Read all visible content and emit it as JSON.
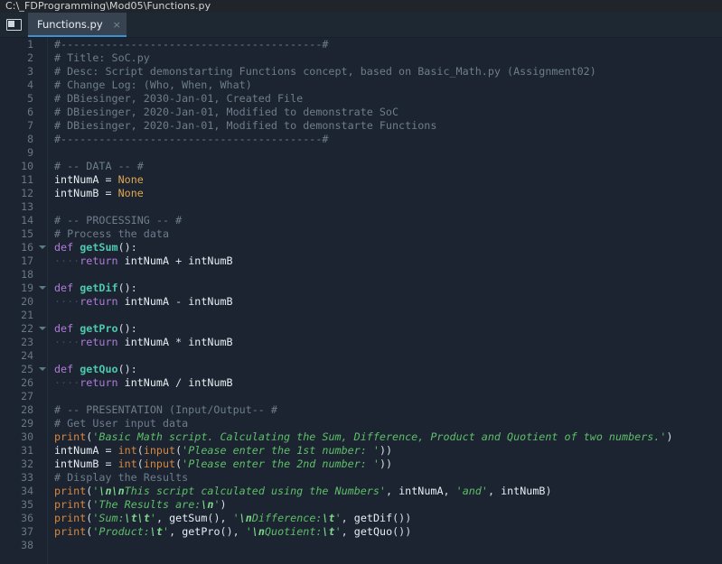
{
  "window": {
    "title": "C:\\_FDProgramming\\Mod05\\Functions.py"
  },
  "icons": {
    "panel": "panel-icon",
    "close": "×"
  },
  "tabs": [
    {
      "label": "Functions.py",
      "active": true,
      "close": "×"
    }
  ],
  "editor": {
    "first_line": 1,
    "last_line": 38,
    "fold_lines": [
      16,
      19,
      22,
      25
    ],
    "colors": {
      "background": "#1b2430",
      "gutter": "#1b2430",
      "line_number": "#697786",
      "text": "#d6dde4",
      "comment": "#6e7d8c",
      "keyword": "#b07cd8",
      "function_def": "#4ec9b0",
      "builtin": "#d8873f",
      "string": "#5fbf6a",
      "constant": "#e0a852",
      "tab_accent": "#3f90d0",
      "tab_active_bg": "#374350",
      "titlebar_bg": "#20252b"
    },
    "lines": [
      {
        "n": 1,
        "tokens": [
          {
            "c": "t-com",
            "t": "#-----------------------------------------#"
          }
        ]
      },
      {
        "n": 2,
        "tokens": [
          {
            "c": "t-com",
            "t": "# Title: SoC.py"
          }
        ]
      },
      {
        "n": 3,
        "tokens": [
          {
            "c": "t-com",
            "t": "# Desc: Script demonstarting Functions concept, based on Basic_Math.py (Assignment02)"
          }
        ]
      },
      {
        "n": 4,
        "tokens": [
          {
            "c": "t-com",
            "t": "# Change Log: (Who, When, What)"
          }
        ]
      },
      {
        "n": 5,
        "tokens": [
          {
            "c": "t-com",
            "t": "# DBiesinger, 2030-Jan-01, Created File"
          }
        ]
      },
      {
        "n": 6,
        "tokens": [
          {
            "c": "t-com",
            "t": "# DBiesinger, 2020-Jan-01, Modified to demonstrate SoC"
          }
        ]
      },
      {
        "n": 7,
        "tokens": [
          {
            "c": "t-com",
            "t": "# DBiesinger, 2020-Jan-01, Modified to demonstarte Functions"
          }
        ]
      },
      {
        "n": 8,
        "tokens": [
          {
            "c": "t-com",
            "t": "#-----------------------------------------#"
          }
        ]
      },
      {
        "n": 9,
        "tokens": []
      },
      {
        "n": 10,
        "tokens": [
          {
            "c": "t-com",
            "t": "# -- DATA -- #"
          }
        ]
      },
      {
        "n": 11,
        "tokens": [
          {
            "c": "t-var",
            "t": "intNumA"
          },
          {
            "c": "t-op",
            "t": " = "
          },
          {
            "c": "t-none",
            "t": "None"
          }
        ]
      },
      {
        "n": 12,
        "tokens": [
          {
            "c": "t-var",
            "t": "intNumB"
          },
          {
            "c": "t-op",
            "t": " = "
          },
          {
            "c": "t-none",
            "t": "None"
          }
        ]
      },
      {
        "n": 13,
        "tokens": []
      },
      {
        "n": 14,
        "tokens": [
          {
            "c": "t-com",
            "t": "# -- PROCESSING -- #"
          }
        ]
      },
      {
        "n": 15,
        "tokens": [
          {
            "c": "t-com",
            "t": "# Process the data"
          }
        ]
      },
      {
        "n": 16,
        "tokens": [
          {
            "c": "t-kw",
            "t": "def"
          },
          {
            "c": "t-op",
            "t": " "
          },
          {
            "c": "t-def",
            "t": "getSum"
          },
          {
            "c": "t-punc",
            "t": "():"
          }
        ]
      },
      {
        "n": 17,
        "tokens": [
          {
            "c": "t-dot",
            "t": "····"
          },
          {
            "c": "t-kw",
            "t": "return"
          },
          {
            "c": "t-op",
            "t": " "
          },
          {
            "c": "t-var",
            "t": "intNumA"
          },
          {
            "c": "t-op",
            "t": " + "
          },
          {
            "c": "t-var",
            "t": "intNumB"
          }
        ]
      },
      {
        "n": 18,
        "tokens": []
      },
      {
        "n": 19,
        "tokens": [
          {
            "c": "t-kw",
            "t": "def"
          },
          {
            "c": "t-op",
            "t": " "
          },
          {
            "c": "t-def",
            "t": "getDif"
          },
          {
            "c": "t-punc",
            "t": "():"
          }
        ]
      },
      {
        "n": 20,
        "tokens": [
          {
            "c": "t-dot",
            "t": "····"
          },
          {
            "c": "t-kw",
            "t": "return"
          },
          {
            "c": "t-op",
            "t": " "
          },
          {
            "c": "t-var",
            "t": "intNumA"
          },
          {
            "c": "t-op",
            "t": " - "
          },
          {
            "c": "t-var",
            "t": "intNumB"
          }
        ]
      },
      {
        "n": 21,
        "tokens": []
      },
      {
        "n": 22,
        "tokens": [
          {
            "c": "t-kw",
            "t": "def"
          },
          {
            "c": "t-op",
            "t": " "
          },
          {
            "c": "t-def",
            "t": "getPro"
          },
          {
            "c": "t-punc",
            "t": "():"
          }
        ]
      },
      {
        "n": 23,
        "tokens": [
          {
            "c": "t-dot",
            "t": "····"
          },
          {
            "c": "t-kw",
            "t": "return"
          },
          {
            "c": "t-op",
            "t": " "
          },
          {
            "c": "t-var",
            "t": "intNumA"
          },
          {
            "c": "t-op",
            "t": " * "
          },
          {
            "c": "t-var",
            "t": "intNumB"
          }
        ]
      },
      {
        "n": 24,
        "tokens": []
      },
      {
        "n": 25,
        "tokens": [
          {
            "c": "t-kw",
            "t": "def"
          },
          {
            "c": "t-op",
            "t": " "
          },
          {
            "c": "t-def",
            "t": "getQuo"
          },
          {
            "c": "t-punc",
            "t": "():"
          }
        ]
      },
      {
        "n": 26,
        "tokens": [
          {
            "c": "t-dot",
            "t": "····"
          },
          {
            "c": "t-kw",
            "t": "return"
          },
          {
            "c": "t-op",
            "t": " "
          },
          {
            "c": "t-var",
            "t": "intNumA"
          },
          {
            "c": "t-op",
            "t": " / "
          },
          {
            "c": "t-var",
            "t": "intNumB"
          }
        ]
      },
      {
        "n": 27,
        "tokens": []
      },
      {
        "n": 28,
        "tokens": [
          {
            "c": "t-com",
            "t": "# -- PRESENTATION (Input/Output-- #"
          }
        ]
      },
      {
        "n": 29,
        "tokens": [
          {
            "c": "t-com",
            "t": "# Get User input data"
          }
        ]
      },
      {
        "n": 30,
        "tokens": [
          {
            "c": "t-bif",
            "t": "print"
          },
          {
            "c": "t-punc",
            "t": "("
          },
          {
            "c": "t-str",
            "t": "'Basic Math script. Calculating the Sum, Difference, Product and Quotient of two numbers.'"
          },
          {
            "c": "t-punc",
            "t": ")"
          }
        ]
      },
      {
        "n": 31,
        "tokens": [
          {
            "c": "t-var",
            "t": "intNumA"
          },
          {
            "c": "t-op",
            "t": " = "
          },
          {
            "c": "t-bif",
            "t": "int"
          },
          {
            "c": "t-punc",
            "t": "("
          },
          {
            "c": "t-bif",
            "t": "input"
          },
          {
            "c": "t-punc",
            "t": "("
          },
          {
            "c": "t-str",
            "t": "'Please enter the 1st number: '"
          },
          {
            "c": "t-punc",
            "t": "))"
          }
        ]
      },
      {
        "n": 32,
        "tokens": [
          {
            "c": "t-var",
            "t": "intNumB"
          },
          {
            "c": "t-op",
            "t": " = "
          },
          {
            "c": "t-bif",
            "t": "int"
          },
          {
            "c": "t-punc",
            "t": "("
          },
          {
            "c": "t-bif",
            "t": "input"
          },
          {
            "c": "t-punc",
            "t": "("
          },
          {
            "c": "t-str",
            "t": "'Please enter the 2nd number: '"
          },
          {
            "c": "t-punc",
            "t": "))"
          }
        ]
      },
      {
        "n": 33,
        "tokens": [
          {
            "c": "t-com",
            "t": "# Display the Results"
          }
        ]
      },
      {
        "n": 34,
        "tokens": [
          {
            "c": "t-bif",
            "t": "print"
          },
          {
            "c": "t-punc",
            "t": "("
          },
          {
            "c": "t-str",
            "t": "'"
          },
          {
            "c": "t-esc",
            "t": "\\n\\n"
          },
          {
            "c": "t-str",
            "t": "This script calculated using the Numbers'"
          },
          {
            "c": "t-punc",
            "t": ", "
          },
          {
            "c": "t-var",
            "t": "intNumA"
          },
          {
            "c": "t-punc",
            "t": ", "
          },
          {
            "c": "t-str",
            "t": "'and'"
          },
          {
            "c": "t-punc",
            "t": ", "
          },
          {
            "c": "t-var",
            "t": "intNumB"
          },
          {
            "c": "t-punc",
            "t": ")"
          }
        ]
      },
      {
        "n": 35,
        "tokens": [
          {
            "c": "t-bif",
            "t": "print"
          },
          {
            "c": "t-punc",
            "t": "("
          },
          {
            "c": "t-str",
            "t": "'The Results are:"
          },
          {
            "c": "t-esc",
            "t": "\\n"
          },
          {
            "c": "t-str",
            "t": "'"
          },
          {
            "c": "t-punc",
            "t": ")"
          }
        ]
      },
      {
        "n": 36,
        "tokens": [
          {
            "c": "t-bif",
            "t": "print"
          },
          {
            "c": "t-punc",
            "t": "("
          },
          {
            "c": "t-str",
            "t": "'Sum:"
          },
          {
            "c": "t-esc",
            "t": "\\t\\t"
          },
          {
            "c": "t-str",
            "t": "'"
          },
          {
            "c": "t-punc",
            "t": ", "
          },
          {
            "c": "t-var",
            "t": "getSum"
          },
          {
            "c": "t-punc",
            "t": "(), "
          },
          {
            "c": "t-str",
            "t": "'"
          },
          {
            "c": "t-esc",
            "t": "\\n"
          },
          {
            "c": "t-str",
            "t": "Difference:"
          },
          {
            "c": "t-esc",
            "t": "\\t"
          },
          {
            "c": "t-str",
            "t": "'"
          },
          {
            "c": "t-punc",
            "t": ", "
          },
          {
            "c": "t-var",
            "t": "getDif"
          },
          {
            "c": "t-punc",
            "t": "())"
          }
        ]
      },
      {
        "n": 37,
        "tokens": [
          {
            "c": "t-bif",
            "t": "print"
          },
          {
            "c": "t-punc",
            "t": "("
          },
          {
            "c": "t-str",
            "t": "'Product:"
          },
          {
            "c": "t-esc",
            "t": "\\t"
          },
          {
            "c": "t-str",
            "t": "'"
          },
          {
            "c": "t-punc",
            "t": ", "
          },
          {
            "c": "t-var",
            "t": "getPro"
          },
          {
            "c": "t-punc",
            "t": "(), "
          },
          {
            "c": "t-str",
            "t": "'"
          },
          {
            "c": "t-esc",
            "t": "\\n"
          },
          {
            "c": "t-str",
            "t": "Quotient:"
          },
          {
            "c": "t-esc",
            "t": "\\t"
          },
          {
            "c": "t-str",
            "t": "'"
          },
          {
            "c": "t-punc",
            "t": ", "
          },
          {
            "c": "t-var",
            "t": "getQuo"
          },
          {
            "c": "t-punc",
            "t": "())"
          }
        ]
      },
      {
        "n": 38,
        "tokens": []
      }
    ]
  }
}
